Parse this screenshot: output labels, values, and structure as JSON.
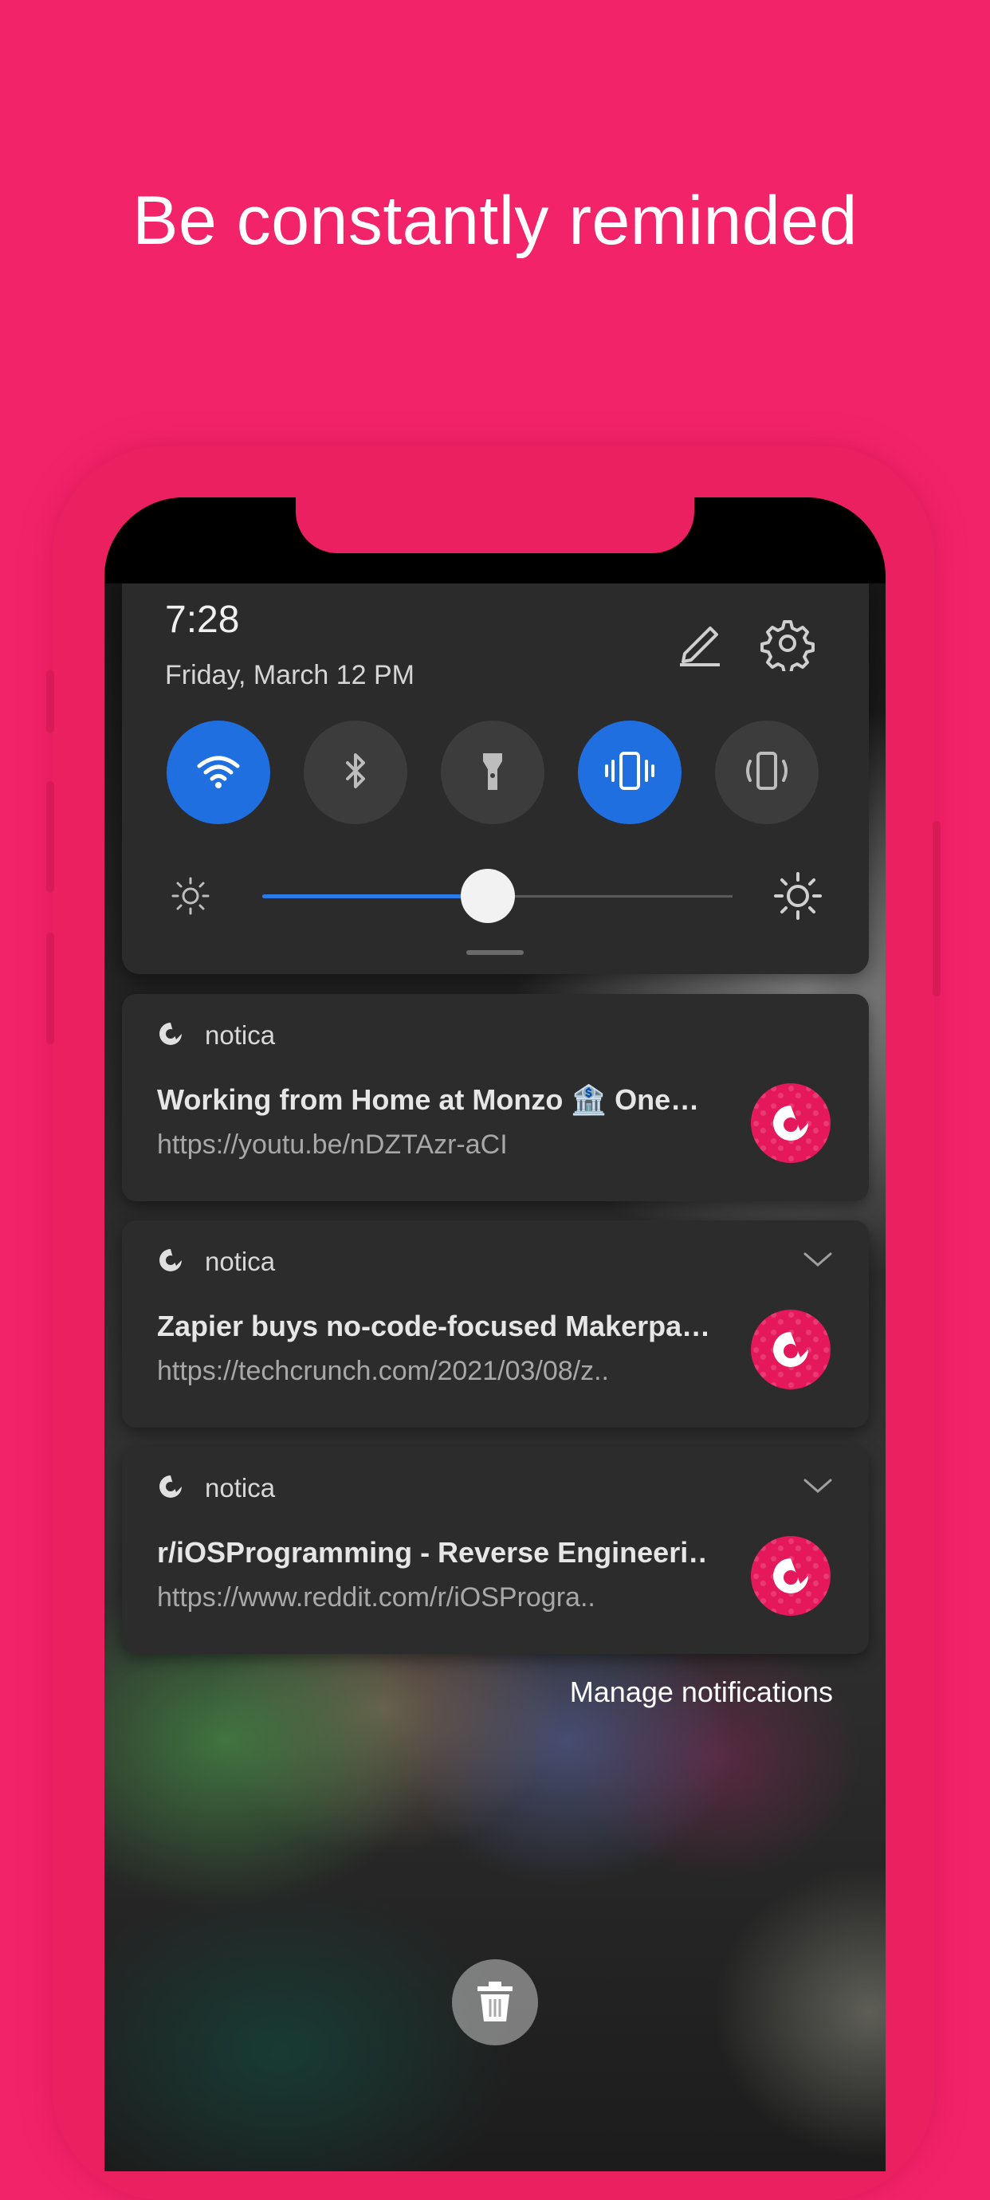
{
  "headline": "Be constantly reminded",
  "colors": {
    "background": "#f3236a",
    "accent_blue": "#1f6fe0",
    "brand_pink": "#e5185b"
  },
  "quick_settings": {
    "time": "7:28",
    "date": "Friday, March 12  PM",
    "edit_icon": "pencil-icon",
    "settings_icon": "gear-icon",
    "tiles": [
      {
        "name": "wifi",
        "icon": "wifi-icon",
        "on": true
      },
      {
        "name": "bluetooth",
        "icon": "bluetooth-icon",
        "on": false
      },
      {
        "name": "flashlight",
        "icon": "flashlight-icon",
        "on": false
      },
      {
        "name": "vibrate",
        "icon": "vibrate-icon",
        "on": true
      },
      {
        "name": "auto-rotate",
        "icon": "rotate-icon",
        "on": false
      }
    ],
    "brightness_level": 0.48
  },
  "notifications": [
    {
      "app": "notica",
      "title": "Working from Home at Monzo 🏦 One…",
      "url": "https://youtu.be/nDZTAzr-aCI",
      "expandable": false
    },
    {
      "app": "notica",
      "title": "Zapier buys no-code-focused Makerpa…",
      "url": "https://techcrunch.com/2021/03/08/z..",
      "expandable": true
    },
    {
      "app": "notica",
      "title": "r/iOSProgramming - Reverse Engineeri…",
      "url": "https://www.reddit.com/r/iOSProgra..",
      "expandable": true
    }
  ],
  "manage_notifications": "Manage notifications",
  "clear_icon": "trash-icon"
}
